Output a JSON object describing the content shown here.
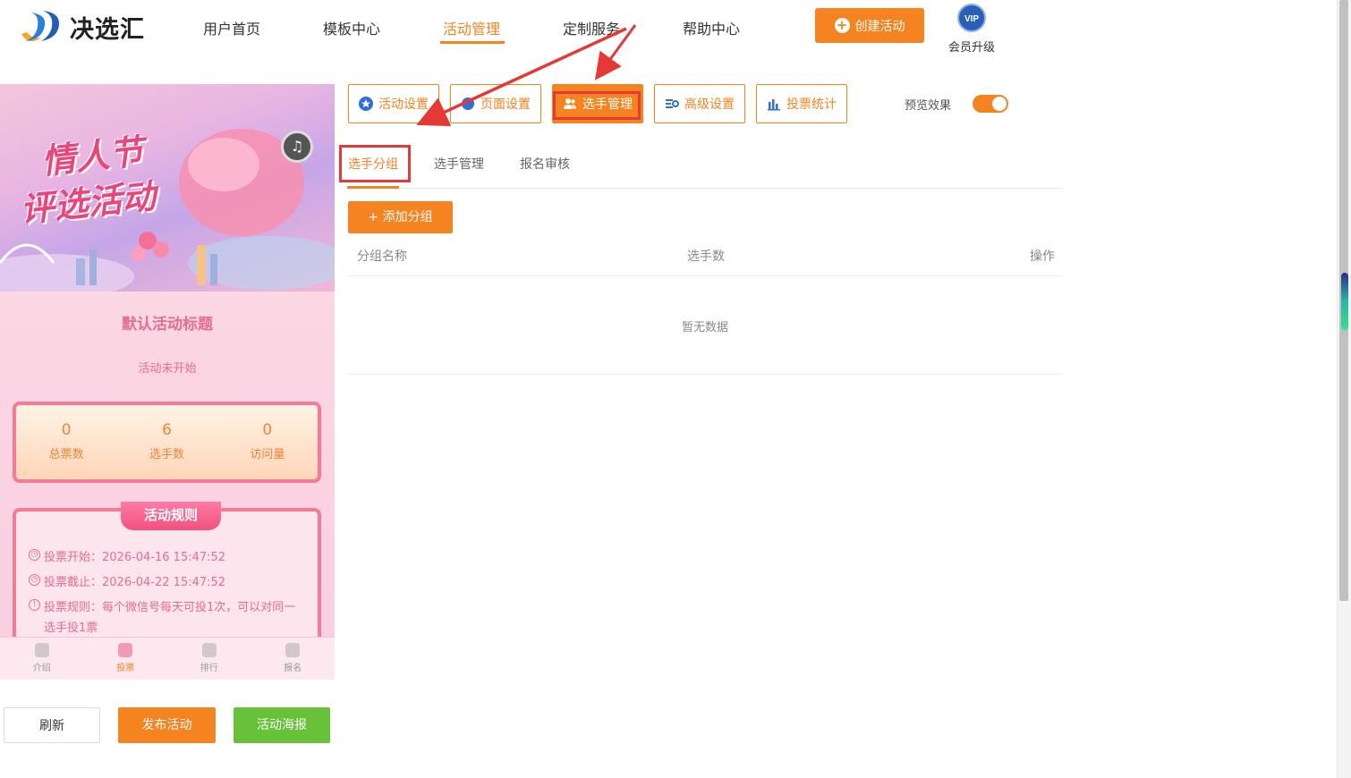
{
  "header": {
    "logo_text": "决选汇",
    "nav": [
      "用户首页",
      "模板中心",
      "活动管理",
      "定制服务",
      "帮助中心"
    ],
    "active_nav": "活动管理",
    "create_button": "创建活动",
    "vip_badge": "VIP",
    "vip_label": "会员升级"
  },
  "preview": {
    "banner_line1": "情人节",
    "banner_line2": "评选活动",
    "title": "默认活动标题",
    "status": "活动未开始",
    "stats": [
      {
        "value": "0",
        "label": "总票数"
      },
      {
        "value": "6",
        "label": "选手数"
      },
      {
        "value": "0",
        "label": "访问量"
      }
    ],
    "rules_title": "活动规则",
    "rules": [
      {
        "icon": "clock-icon",
        "text": "投票开始：2026-04-16 15:47:52"
      },
      {
        "icon": "clock-icon",
        "text": "投票截止：2026-04-22 15:47:52"
      },
      {
        "icon": "info-icon",
        "text": "投票规则：每个微信号每天可投1次，可以对同一选手投1票"
      }
    ],
    "tabbar": [
      "介绍",
      "投票",
      "排行",
      "报名"
    ],
    "active_tab": "投票"
  },
  "actions": {
    "refresh": "刷新",
    "publish": "发布活动",
    "poster": "活动海报"
  },
  "toolbar": {
    "items": [
      "活动设置",
      "页面设置",
      "选手管理",
      "高级设置",
      "投票统计"
    ],
    "active": "选手管理",
    "preview_label": "预览效果",
    "preview_on": true
  },
  "subtabs": {
    "items": [
      "选手分组",
      "选手管理",
      "报名审核"
    ],
    "active": "选手分组"
  },
  "add_group_button": "+ 添加分组",
  "table": {
    "columns": [
      "分组名称",
      "选手数",
      "操作"
    ],
    "empty_text": "暂无数据"
  },
  "colors": {
    "accent": "#f5831f",
    "highlight": "#e53935",
    "green": "#67c23a"
  }
}
